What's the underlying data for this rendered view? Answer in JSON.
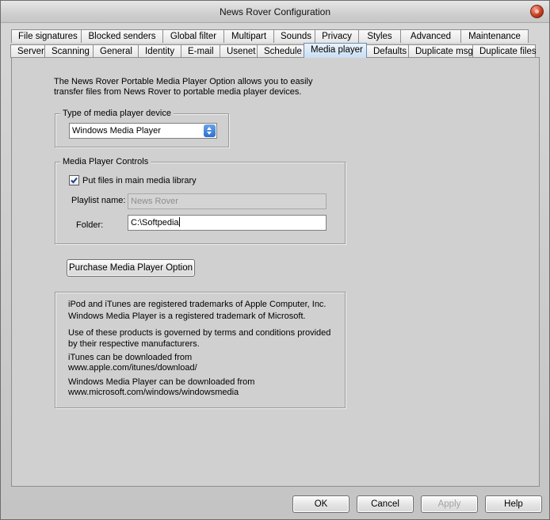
{
  "window": {
    "title": "News Rover Configuration"
  },
  "tabs": {
    "row1": [
      "File signatures",
      "Blocked senders",
      "Global filter",
      "Multipart",
      "Sounds",
      "Privacy",
      "Styles",
      "Advanced",
      "Maintenance"
    ],
    "row2": [
      "Server",
      "Scanning",
      "General",
      "Identity",
      "E-mail",
      "Usenet",
      "Schedule",
      "Media player",
      "Defaults",
      "Duplicate msg",
      "Duplicate files"
    ],
    "active": "Media player"
  },
  "media_player": {
    "intro": "The News Rover Portable Media Player Option allows you to easily transfer files from News Rover to portable media player devices.",
    "device_group": {
      "label": "Type of media player device",
      "selected": "Windows Media Player"
    },
    "controls_group": {
      "label": "Media Player Controls",
      "put_files_label": "Put files in main media library",
      "put_files_checked": true,
      "playlist_label": "Playlist name:",
      "playlist_value": "News Rover",
      "folder_label": "Folder:",
      "folder_value": "C:\\Softpedia"
    },
    "purchase_button": "Purchase Media Player Option",
    "info": {
      "line1": "iPod and iTunes are registered trademarks of Apple Computer, Inc.",
      "line2": "Windows Media Player is a registered trademark of Microsoft.",
      "line3": "Use of these products is governed by terms and conditions provided",
      "line4": "by their respective manufacturers.",
      "line5": "iTunes can be downloaded from",
      "line6": "www.apple.com/itunes/download/",
      "line7": "Windows Media Player can be downloaded from",
      "line8": "www.microsoft.com/windows/windowsmedia"
    }
  },
  "footer": {
    "ok": "OK",
    "cancel": "Cancel",
    "apply": "Apply",
    "help": "Help"
  }
}
